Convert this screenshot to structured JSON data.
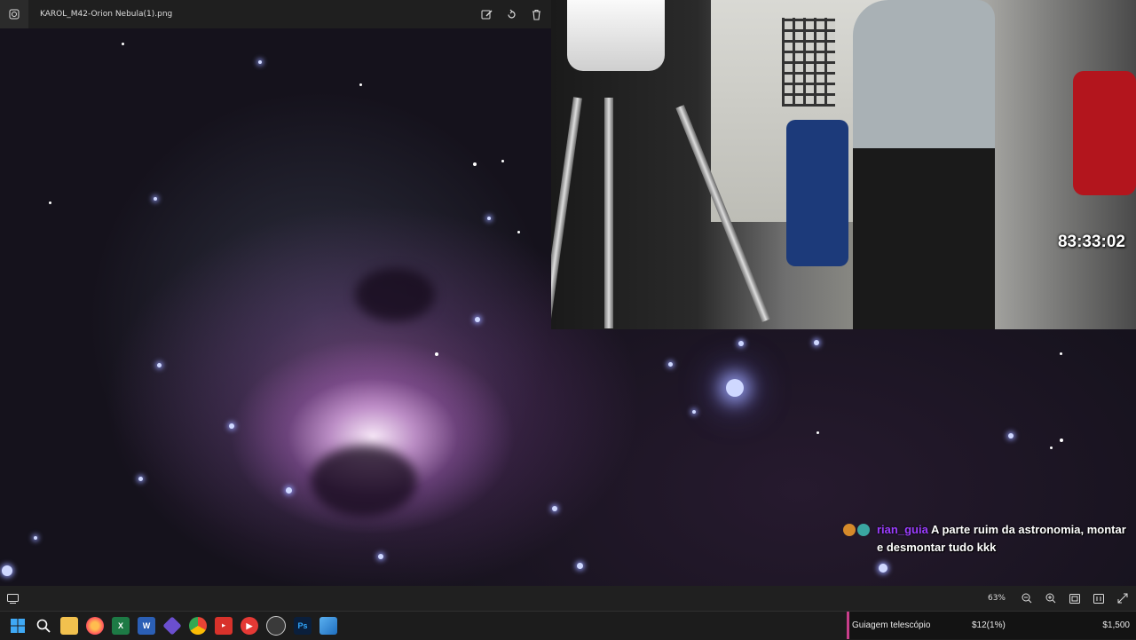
{
  "viewer": {
    "title": "KAROL_M42-Orion Nebula(1).png",
    "zoom": "63%",
    "toolbar_icons": [
      "edit-icon",
      "rotate-icon",
      "delete-icon"
    ],
    "status_icons": [
      "zoom-out-icon",
      "zoom-in-icon",
      "fit-to-window-icon",
      "actual-size-icon",
      "fullscreen-icon"
    ]
  },
  "stream": {
    "timer": "83:33:02",
    "chat": {
      "username": "rian_guia",
      "message": "A parte ruim da astronomia, montar e desmontar tudo kkk",
      "username_color": "#9b3dff"
    },
    "goal": {
      "label": "Guiagem telescópio",
      "progress": "$12(1%)",
      "target": "$1,500",
      "accent_color": "#c83e8a"
    }
  },
  "taskbar": {
    "apps": [
      "windows-start",
      "search",
      "file-explorer",
      "firefox",
      "excel",
      "word",
      "obsidian",
      "chrome",
      "video-editor",
      "media-player",
      "obs-studio",
      "photoshop",
      "photos"
    ]
  }
}
